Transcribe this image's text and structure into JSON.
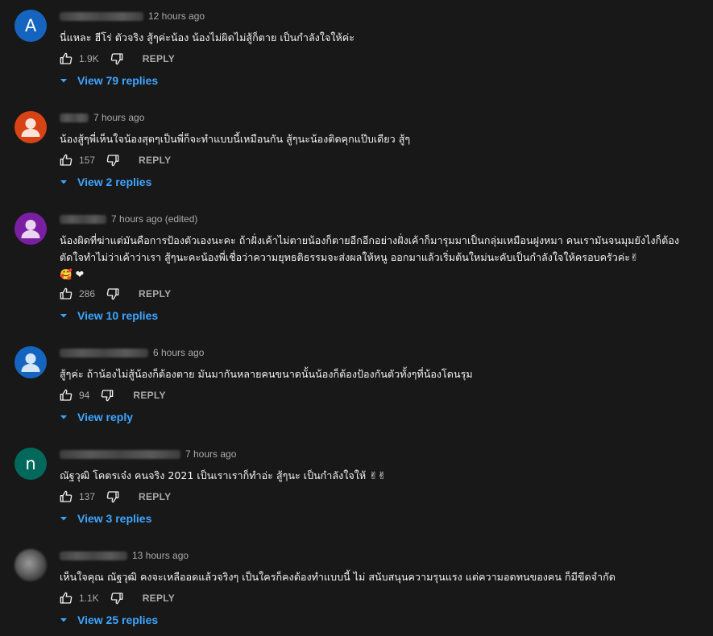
{
  "actions": {
    "reply_label": "REPLY"
  },
  "colors": {
    "background": "#181818",
    "link": "#3ea6ff",
    "muted": "#aaaaaa"
  },
  "comments": [
    {
      "avatar_letter": "A",
      "avatar_color": "#1565c0",
      "time": "12 hours ago",
      "text": "นี่แหละ ฮีโร่ ตัวจริง สู้ๆค่ะน้อง น้องไม่ผิดไม่สู้ก็ตาย เป็นกำลังใจให้ค่ะ",
      "likes": "1.9K",
      "view_replies": "View 79 replies"
    },
    {
      "avatar_icon": "person-icon",
      "avatar_color": "#d84315",
      "time": "7 hours ago",
      "text": "น้องสู้ๆพี่เห็นใจน้องสุดๆเป็นพี่ก็จะทำแบบนี้เหมือนกัน สู้ๆนะน้องติดคุกแป๊บเดียว สู้ๆ",
      "likes": "157",
      "view_replies": "View 2 replies"
    },
    {
      "avatar_icon": "person-icon",
      "avatar_color": "#7b1fa2",
      "time": "7 hours ago (edited)",
      "text": "น้องผิดที่ฆ่าแต่มันคือการป้องตัวเองนะคะ ถ้าฝั่งเค้าไม่ตายน้องก็ตายอีกอีกอย่างฝั่งเค้าก็มารุมมาเป็นกลุ่มเหมือนฝูงหมา คนเรามันจนมุมยังไงก็ต้องตัดใจทำไม่ว่าเค้าว่าเรา สู้ๆนะคะน้องพี่เชื่อว่าความยุทธติธรรมจะส่งผลให้หนู ออกมาแล้วเริ่มต้นใหม่นะคับเป็นกำลังใจให้ครอบครัวค่ะ✌\n🥰 ❤",
      "likes": "286",
      "view_replies": "View 10 replies"
    },
    {
      "avatar_icon": "person-icon",
      "avatar_color": "#1565c0",
      "time": "6 hours ago",
      "text": "สู้ๆค่ะ ถ้าน้องไม่สู้น้องก็ต้องตาย มันมากันหลายคนขนาดนั้นน้องก็ต้องป้องกันตัวทั้งๆที่น้องโดนรุม",
      "likes": "94",
      "view_replies": "View reply"
    },
    {
      "avatar_letter": "n",
      "avatar_color": "#00695c",
      "time": "7 hours ago",
      "text": "ณัฐวุฒิ โคตรเจ๋ง คนจริง 2021 เป็นเราเราก็ทำอ่ะ สู้ๆนะ เป็นกำลังใจให้ ✌✌",
      "likes": "137",
      "view_replies": "View 3 replies"
    },
    {
      "avatar_photo": true,
      "time": "13 hours ago",
      "text": "เห็นใจคุณ ณัฐวุฒิ คงจะเหลืออดแล้วจริงๆ เป็นใครก็คงต้องทำแบบนี้ ไม่ สนับสนุนความรุนแรง แต่ความอดทนของคน ก็มีขีดจำกัด",
      "likes": "1.1K",
      "view_replies": "View 25 replies"
    }
  ]
}
